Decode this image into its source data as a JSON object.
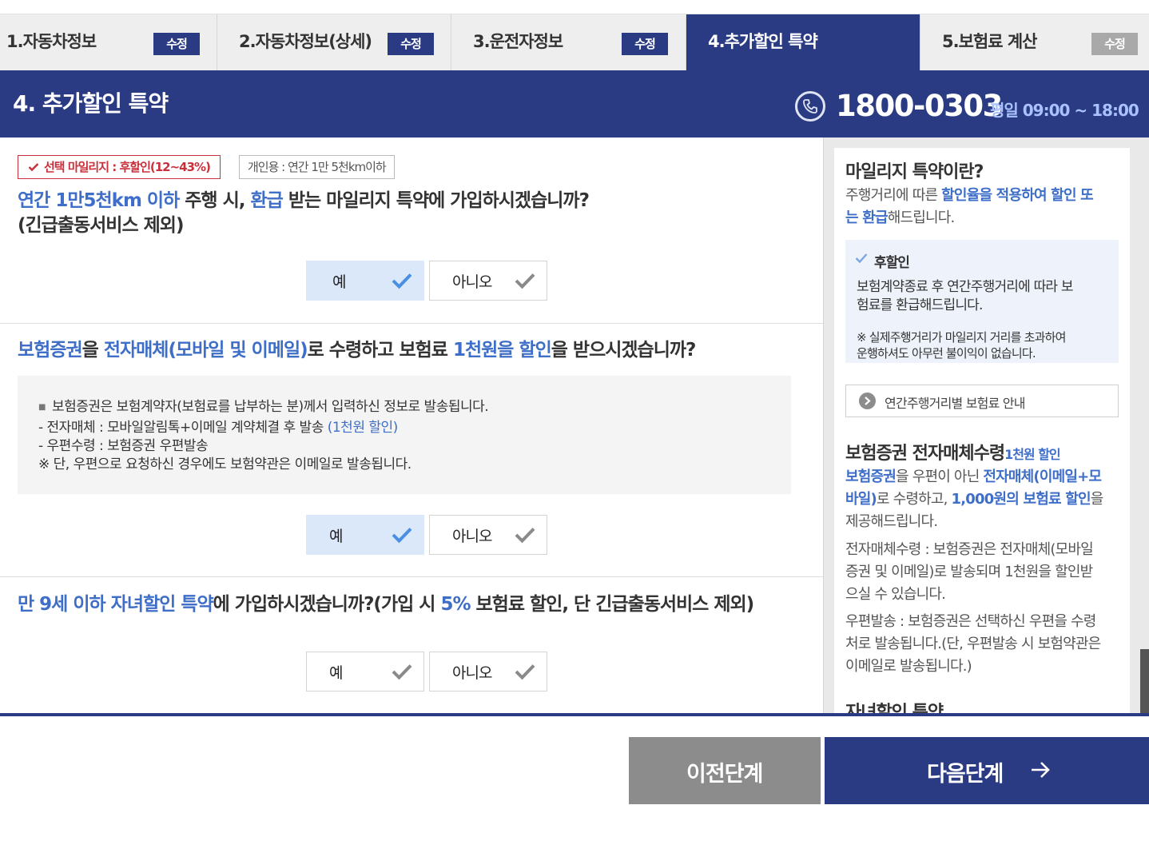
{
  "steps": [
    {
      "label": "1.자동차정보",
      "edit": "수정"
    },
    {
      "label": "2.자동차정보(상세)",
      "edit": "수정"
    },
    {
      "label": "3.운전자정보",
      "edit": "수정"
    },
    {
      "label": "4.추가할인 특약"
    },
    {
      "label": "5.보험료 계산",
      "edit": "수정"
    }
  ],
  "header": {
    "title": "4. 추가할인 특약",
    "phone": "1800-0303",
    "hours": "평일 09:00 ~ 18:00"
  },
  "q1": {
    "chip_selected": "선택 마일리지 : 후할인(12~43%)",
    "chip_info": "개인용 : 연간 1만 5천km이하",
    "p1": "연간 1만5천km 이하",
    "p2": " 주행 시, ",
    "p3": "환급",
    "p4": " 받는 마일리지 특약에 가입하시겠습니까?",
    "line2": "(긴급출동서비스 제외)",
    "yes": "예",
    "no": "아니오",
    "selected": "yes"
  },
  "q2": {
    "p1": "보험증권",
    "p2": "을 ",
    "p3": "전자매체(모바일 및 이메일)",
    "p4": "로 수령하고 보험료 ",
    "p5": "1천원을 할인",
    "p6": "을 받으시겠습니까?",
    "info1": "보험증권은 보험계약자(보험료를 납부하는 분)께서 입력하신 정보로 발송됩니다.",
    "info2a": "- 전자매체 : 모바일알림톡+이메일 계약체결 후 발송 ",
    "info2b": "(1천원 할인)",
    "info3": "- 우편수령 : 보험증권 우편발송",
    "info4": "※ 단, 우편으로 요청하신 경우에도 보험약관은 이메일로 발송됩니다.",
    "yes": "예",
    "no": "아니오",
    "selected": "yes"
  },
  "q3": {
    "p1": "만 9세 이하 자녀할인 특약",
    "p2": "에 가입하시겠습니까?(가입 시 ",
    "p3": "5%",
    "p4": " 보험료 할인, 단 긴급출동서비스 제외)",
    "yes": "예",
    "no": "아니오",
    "selected": "none"
  },
  "side": {
    "h1": "마일리지 특약이란?",
    "d1a": "주행거리에 따른 ",
    "d1b": "할인율을 적용하여 할인 또",
    "d1c": "는 환급",
    "d1d": "해드립니다.",
    "sub_title": "후할인",
    "sub_body1": "보험계약종료 후 연간주행거리에 따라 보",
    "sub_body2": "험료를 환급해드립니다.",
    "sub_note1": "※ 실제주행거리가 마일리지 거리를 초과하여",
    "sub_note2": "운행하셔도 아무런 불이익이 없습니다.",
    "guide": "연간주행거리별 보험료 안내",
    "h2": "보험증권 전자매체수령",
    "h2_small": "1천원 할인",
    "d2a": "보험증권",
    "d2b": "을 우편이 아닌 ",
    "d2c": "전자매체(이메일+모",
    "d2d": "바일)",
    "d2e": "로 수령하고, ",
    "d2f": "1,000원의 보험료 할인",
    "d2g": "을",
    "d2h": "제공해드립니다.",
    "d3a": "전자매체수령 : 보험증권은 전자매체(모바일",
    "d3b": "증권 및 이메일)로 발송되며 1천원을 할인받",
    "d3c": "으실 수 있습니다.",
    "d4a": "우편발송 : 보험증권은 선택하신 우편을 수령",
    "d4b": "처로 발송됩니다.(단, 우편발송 시 보험약관은",
    "d4c": "이메일로 발송됩니다.)",
    "h3": "자녀할인 특약"
  },
  "nav": {
    "prev": "이전단계",
    "next": "다음단계"
  },
  "colors": {
    "navy": "#2a3b84",
    "accent_blue": "#3e6ec8",
    "selected_bg": "#dbe8fa",
    "chip_red": "#c8313c"
  },
  "icons": [
    "phone-icon",
    "check-icon",
    "chevron-right-icon",
    "arrow-right-icon"
  ]
}
